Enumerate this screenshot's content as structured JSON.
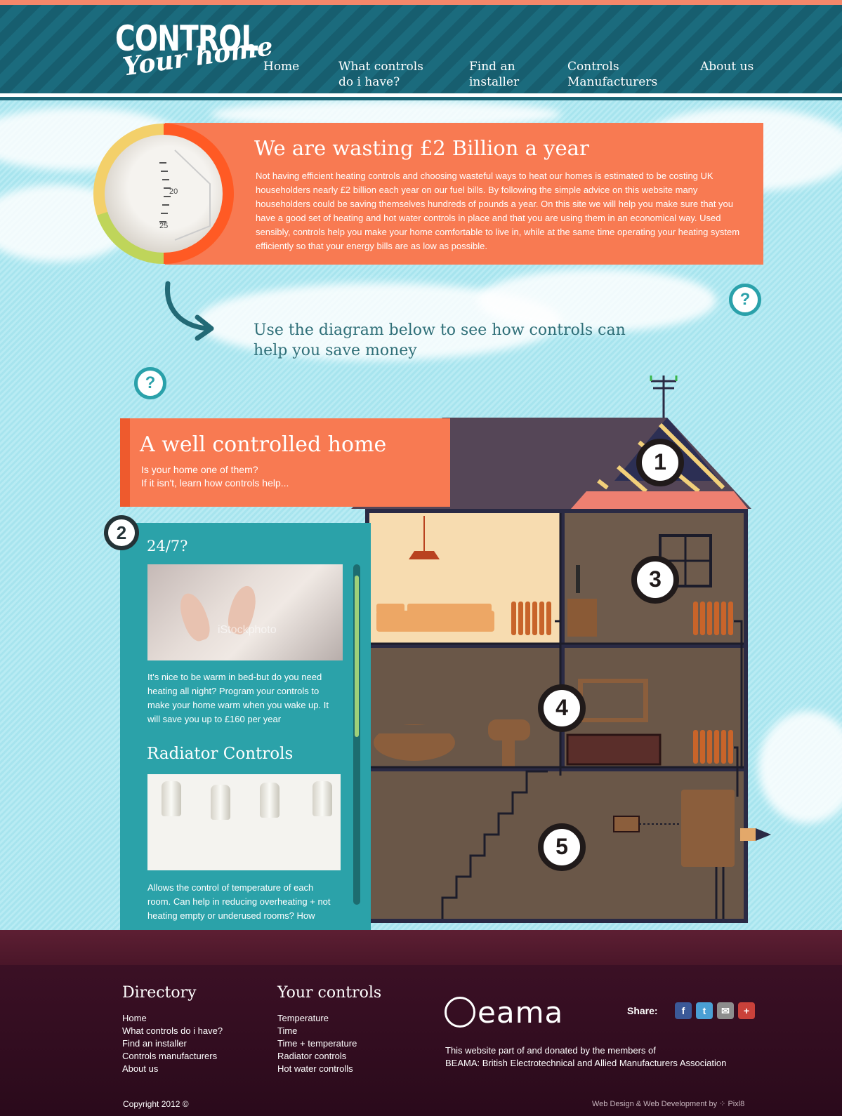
{
  "logo": {
    "main": "CONTROL",
    "sub": "Your home"
  },
  "nav": [
    {
      "label": "Home"
    },
    {
      "label": "What controls",
      "label2": "do i have?"
    },
    {
      "label": "Find an",
      "label2": "installer"
    },
    {
      "label": "Controls",
      "label2": "Manufacturers"
    },
    {
      "label": "About us"
    }
  ],
  "intro": {
    "title": "We are wasting £2 Billion a year",
    "text": "Not having efficient heating controls and choosing wasteful ways to heat our homes is estimated to be costing UK householders nearly £2 billion each year on our fuel bills. By following the simple advice on this website many householders could be saving themselves hundreds of pounds a year. On this site we will help you make sure that you have a good set of heating and hot water controls in place and that you are using them in an economical way. Used sensibly, controls help you make your home comfortable to live in, while at the same time operating your heating system efficiently so that your energy bills are as low as possible.",
    "dial_20": "20",
    "dial_25": "25"
  },
  "diagram_prompt": "Use the diagram below to see how controls can help you save money",
  "help_icon": "?",
  "well": {
    "title": "A well controlled home",
    "sub1": "Is your home one of them?",
    "sub2": "If it isn't, learn how controls help..."
  },
  "side": {
    "number": "2",
    "h1": "24/7?",
    "watermark": "iStockphoto",
    "p1": "It's nice to be warm in bed-but do you need heating all night? Program your controls to make your home warm when you wake up. It will save you up to £160 per year",
    "h2": "Radiator Controls",
    "p2": "Allows the control of temperature of each room. Can help in reducing overheating + not heating empty or underused rooms? How"
  },
  "house_numbers": [
    "1",
    "3",
    "4",
    "5"
  ],
  "footer": {
    "directory_title": "Directory",
    "directory": [
      "Home",
      "What controls do i have?",
      "Find an installer",
      "Controls manufacturers",
      "About us"
    ],
    "controls_title": "Your controls",
    "controls": [
      "Temperature",
      "Time",
      "Time + temperature",
      "Radiator controls",
      "Hot water controlls"
    ],
    "beama_logo": "eama",
    "beama_line1": "This website part of and donated by the members of",
    "beama_line2": "BEAMA: British Electrotechnical and Allied Manufacturers Association",
    "share_label": "Share:",
    "social": [
      {
        "icon": "facebook-icon",
        "glyph": "f",
        "color": "#3b5998"
      },
      {
        "icon": "twitter-icon",
        "glyph": "t",
        "color": "#4a9fd4"
      },
      {
        "icon": "mail-icon",
        "glyph": "✉",
        "color": "#8d8d8d"
      },
      {
        "icon": "plus-icon",
        "glyph": "+",
        "color": "#c9413a"
      }
    ],
    "copyright": "Copyright 2012 ©",
    "credit": "Web Design & Web Development by  ⁘ Pixl8"
  }
}
